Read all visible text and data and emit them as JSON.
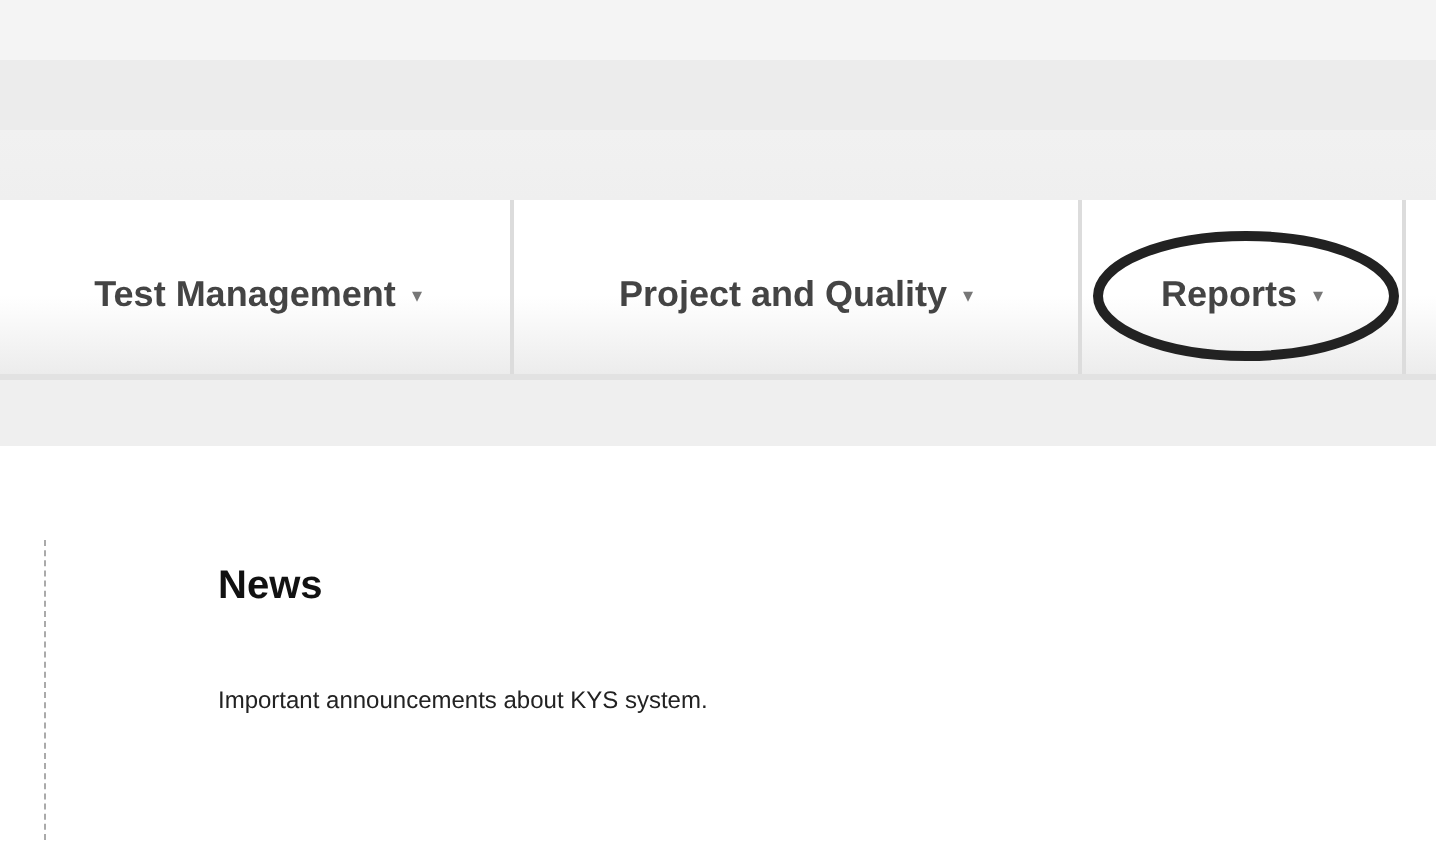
{
  "menu": [
    {
      "label": "Test Management",
      "caret": "▾",
      "circled": false
    },
    {
      "label": "Project and Quality",
      "caret": "▾",
      "circled": false
    },
    {
      "label": "Reports",
      "caret": "▾",
      "circled": true
    }
  ],
  "news": {
    "title": "News",
    "text": "Important announcements about KYS system."
  }
}
